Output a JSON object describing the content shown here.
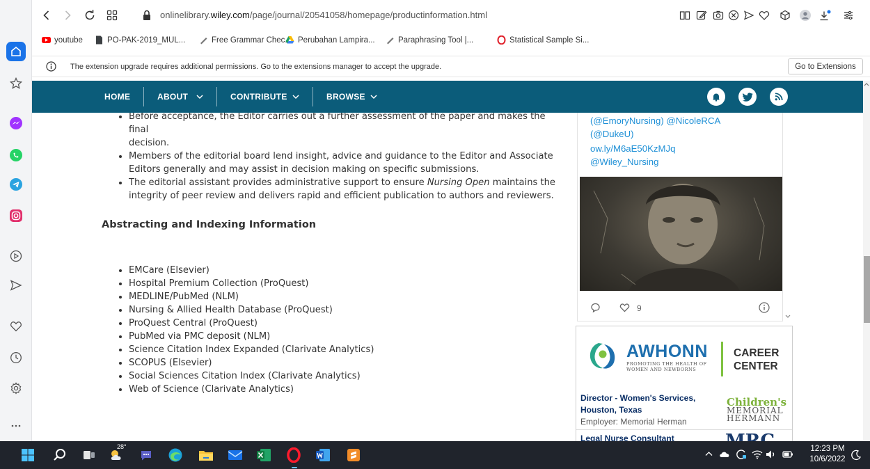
{
  "browser": {
    "url_prefix": "onlinelibrary.",
    "url_host": "wiley.com",
    "url_path": "/page/journal/20541058/homepage/productinformation.html",
    "bookmarks": [
      {
        "label": "youtube",
        "icon": "youtube-icon"
      },
      {
        "label": "PO-PAK-2019_MUL...",
        "icon": "file-icon"
      },
      {
        "label": "Free Grammar Chec...",
        "icon": "pen-icon"
      },
      {
        "label": "Perubahan Lampira...",
        "icon": "drive-icon"
      },
      {
        "label": "Paraphrasing Tool |...",
        "icon": "pen-icon"
      },
      {
        "label": "Statistical Sample Si...",
        "icon": "opera-icon"
      }
    ],
    "infobar": {
      "text": "The extension upgrade requires additional permissions. Go to the extensions manager to accept the upgrade.",
      "button": "Go to Extensions"
    }
  },
  "site_nav": {
    "items": [
      "HOME",
      "ABOUT",
      "CONTRIBUTE",
      "BROWSE"
    ]
  },
  "editorial": {
    "bullets": [
      {
        "lines": [
          "Before acceptance, the Editor carries out a further assessment of the paper and makes the final",
          "decision."
        ]
      },
      {
        "lines": [
          "Members of the editorial board lend insight, advice and guidance to the Editor and Associate",
          "Editors generally and may assist in decision making on specific submissions."
        ]
      },
      {
        "line1_pre": "The editorial assistant provides administrative support to ensure ",
        "line1_em": "Nursing Open",
        "line1_post": " maintains the",
        "line2": "integrity of peer review and delivers rapid and efficient publication to authors and reviewers."
      }
    ]
  },
  "abstracting": {
    "title": "Abstracting and Indexing Information",
    "items": [
      "EMCare (Elsevier)",
      "Hospital Premium Collection (ProQuest)",
      "MEDLINE/PubMed (NLM)",
      "Nursing & Allied Health Database (ProQuest)",
      "ProQuest Central (ProQuest)",
      "PubMed via PMC deposit (NLM)",
      "Science Citation Index Expanded (Clarivate Analytics)",
      "SCOPUS (Elsevier)",
      "Social Sciences Citation Index (Clarivate Analytics)",
      "Web of Science (Clarivate Analytics)"
    ]
  },
  "tweet": {
    "line1a": "(@EmoryNursing)",
    "line1b": "@NicoleRCA",
    "line2": "(@DukeU)",
    "line3": "ow.ly/M6aE50KzMJq",
    "line4": "@Wiley_Nursing",
    "likes": "9"
  },
  "ad": {
    "brand": "AWHONN",
    "tagline1": "PROMOTING THE HEALTH OF",
    "tagline2": "WOMEN AND NEWBORNS",
    "career1": "CAREER",
    "career2": "CENTER",
    "job1_title": "Director - Women's Services,",
    "job1_loc": "Houston, Texas",
    "job1_employer": "Employer: Memorial Herman",
    "job1_logo1": "Children's",
    "job1_logo2": "MEMORIAL",
    "job1_logo3": "HERMANN",
    "job2_title": "Legal Nurse Consultant",
    "job2_logo": "MRC"
  },
  "taskbar": {
    "temperature": "28°",
    "time": "12:23 PM",
    "date": "10/6/2022"
  },
  "colors": {
    "site_nav": "#0b5c7a",
    "link": "#1d8fd6",
    "taskbar": "#20242c"
  }
}
